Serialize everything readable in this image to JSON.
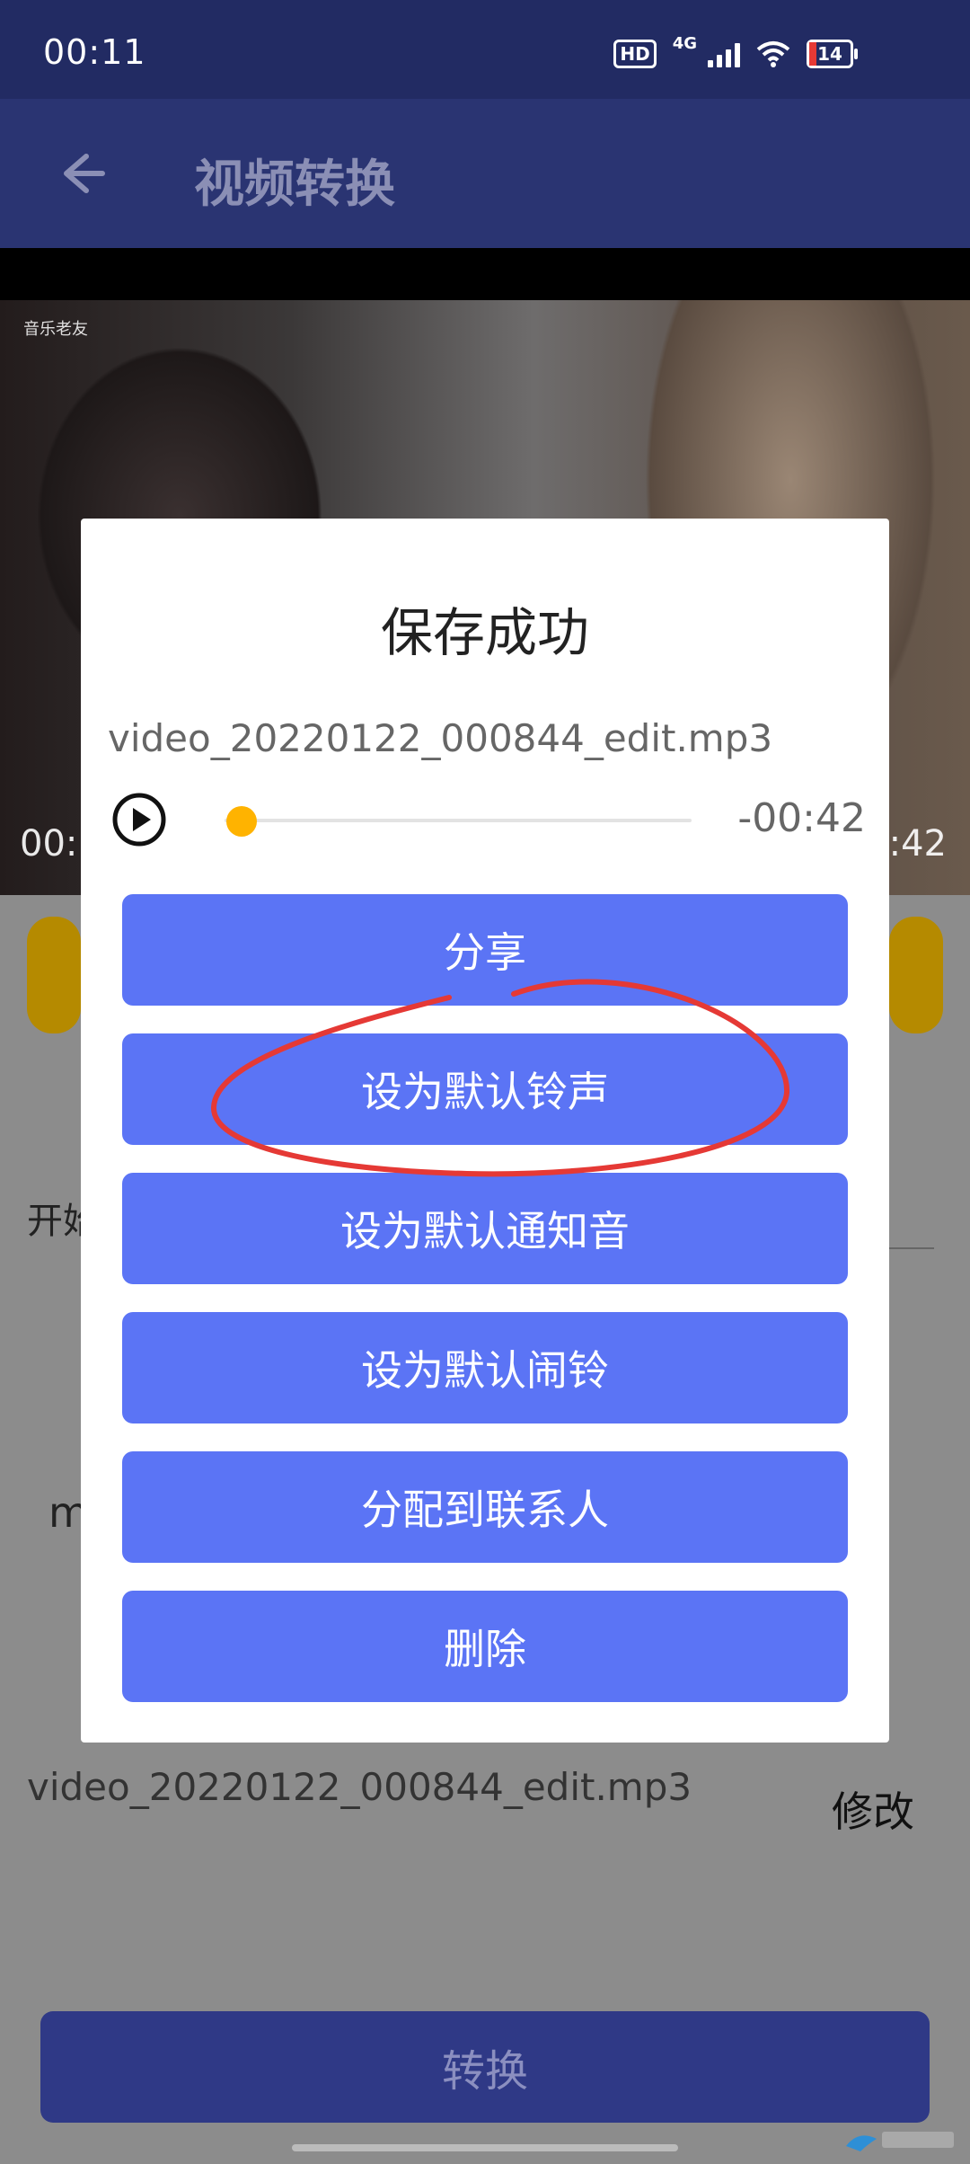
{
  "status_bar": {
    "time": "00:11",
    "network": "4G",
    "hd": "HD",
    "battery": "14"
  },
  "app_bar": {
    "title": "视频转换"
  },
  "video": {
    "watermark": "音乐老友",
    "time_left": "00:",
    "time_right": ":42"
  },
  "background": {
    "start_label": "开始",
    "format_label": "m",
    "file_name": "video_20220122_000844_edit.mp3",
    "modify_label": "修改",
    "convert_label": "转换"
  },
  "dialog": {
    "title": "保存成功",
    "file_name": "video_20220122_000844_edit.mp3",
    "player": {
      "remaining": "-00:42",
      "progress": 0.02
    },
    "buttons": [
      {
        "label": "分享"
      },
      {
        "label": "设为默认铃声"
      },
      {
        "label": "设为默认通知音"
      },
      {
        "label": "设为默认闹铃"
      },
      {
        "label": "分配到联系人"
      },
      {
        "label": "删除"
      }
    ]
  },
  "colors": {
    "accent": "#5b74f5",
    "appbar": "#2a3472",
    "slider_thumb": "#ffb300",
    "annotation": "#e53935"
  }
}
